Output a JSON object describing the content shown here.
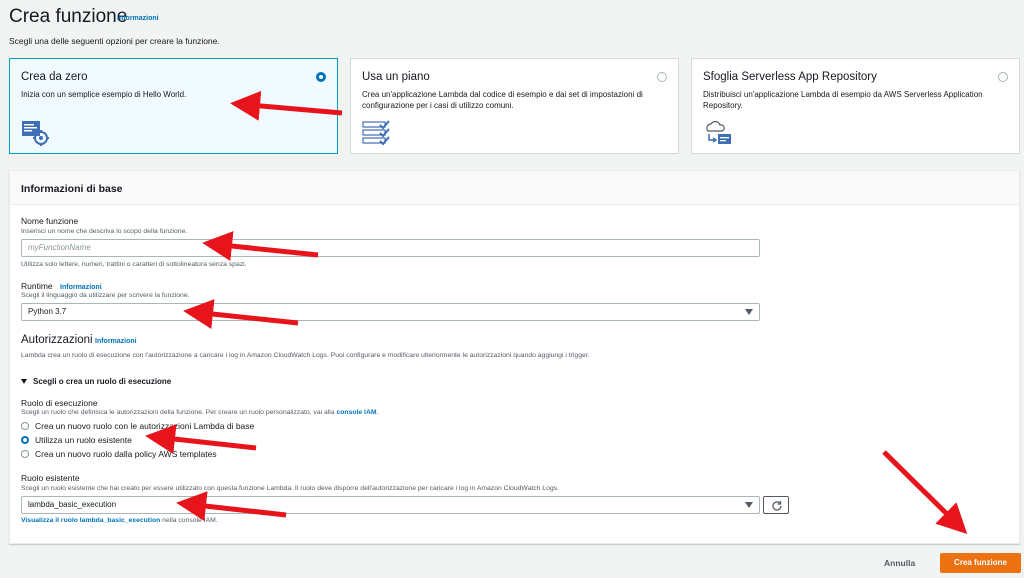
{
  "header": {
    "title": "Crea funzione",
    "info_link": "Informazioni",
    "subtitle": "Scegli una delle seguenti opzioni per creare la funzione."
  },
  "options": [
    {
      "title": "Crea da zero",
      "description": "Inizia con un semplice esempio di Hello World.",
      "selected": true,
      "icon": "code-gear-icon"
    },
    {
      "title": "Usa un piano",
      "description": "Crea un'applicazione Lambda dal codice di esempio e dai set di impostazioni di configurazione per i casi di utilizzo comuni.",
      "selected": false,
      "icon": "checklist-icon"
    },
    {
      "title": "Sfoglia Serverless App Repository",
      "description": "Distribuisci un'applicazione Lambda di esempio da AWS Serverless Application Repository.",
      "selected": false,
      "icon": "cloud-deploy-icon"
    }
  ],
  "basic_info": {
    "title": "Informazioni di base",
    "function_name": {
      "label": "Nome funzione",
      "hint": "Inserisci un nome che descriva lo scopo della funzione.",
      "placeholder": "myFunctionName",
      "constraint": "Utilizza solo lettere, numeri, trattini o caratteri di sottolineatura senza spazi."
    },
    "runtime": {
      "label": "Runtime",
      "info_link": "Informazioni",
      "hint": "Scegli il linguaggio da utilizzare per scrivere la funzione.",
      "value": "Python 3.7"
    },
    "permissions": {
      "title": "Autorizzazioni",
      "info_link": "Informazioni",
      "description": "Lambda crea un ruolo di esecuzione con l'autorizzazione a caricare i log in Amazon CloudWatch Logs. Puoi configurare e modificare ulteriormente le autorizzazioni quando aggiungi i trigger.",
      "expander_label": "Scegli o crea un ruolo di esecuzione",
      "role_label": "Ruolo di esecuzione",
      "role_hint_prefix": "Scegli un ruolo che definisca le autorizzazioni della funzione. Per creare un ruolo personalizzato, vai alla ",
      "role_hint_link": "console IAM",
      "role_hint_suffix": ".",
      "role_options": [
        {
          "label": "Crea un nuovo ruolo con le autorizzazioni Lambda di base",
          "checked": false
        },
        {
          "label": "Utilizza un ruolo esistente",
          "checked": true
        },
        {
          "label": "Crea un nuovo ruolo dalla policy AWS templates",
          "checked": false
        }
      ],
      "existing_role_label": "Ruolo esistente",
      "existing_role_hint": "Scegli un ruolo esistente che hai creato per essere utilizzato con questa funzione Lambda. Il ruolo deve disporre dell'autorizzazione per caricare i log in Amazon CloudWatch Logs.",
      "existing_role_value": "lambda_basic_execution",
      "view_role_link": "Visualizza il ruolo lambda_basic_execution",
      "view_role_suffix": " nella console IAM."
    }
  },
  "footer": {
    "cancel_label": "Annulla",
    "create_label": "Crea funzione"
  },
  "colors": {
    "accent": "#0073bb",
    "primary_button": "#ec7211",
    "annotation_arrow": "#e8141b"
  }
}
